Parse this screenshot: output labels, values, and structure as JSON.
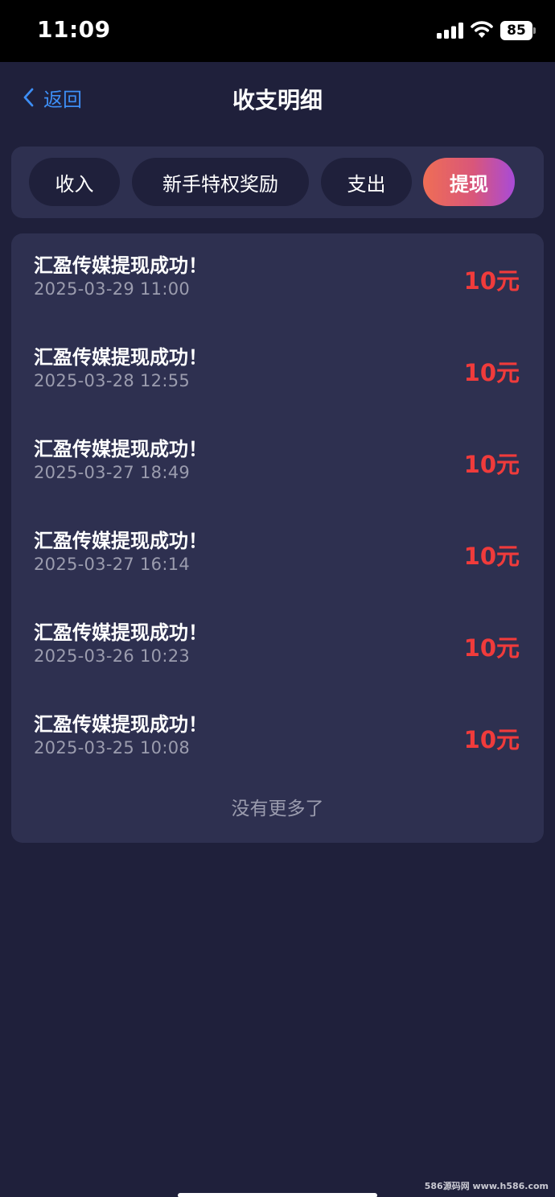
{
  "status_bar": {
    "time": "11:09",
    "battery": "85",
    "icons": [
      "signal-icon",
      "wifi-icon",
      "battery-icon"
    ]
  },
  "nav": {
    "back_label": "返回",
    "title": "收支明细"
  },
  "tabs": [
    {
      "label": "收入",
      "active": false
    },
    {
      "label": "新手特权奖励",
      "active": false
    },
    {
      "label": "支出",
      "active": false
    },
    {
      "label": "提现",
      "active": true
    }
  ],
  "records": [
    {
      "title": "汇盈传媒提现成功！",
      "time": "2025-03-29 11:00",
      "amount": "10元"
    },
    {
      "title": "汇盈传媒提现成功！",
      "time": "2025-03-28 12:55",
      "amount": "10元"
    },
    {
      "title": "汇盈传媒提现成功！",
      "time": "2025-03-27 18:49",
      "amount": "10元"
    },
    {
      "title": "汇盈传媒提现成功！",
      "time": "2025-03-27 16:14",
      "amount": "10元"
    },
    {
      "title": "汇盈传媒提现成功！",
      "time": "2025-03-26 10:23",
      "amount": "10元"
    },
    {
      "title": "汇盈传媒提现成功！",
      "time": "2025-03-25 10:08",
      "amount": "10元"
    }
  ],
  "footer": {
    "no_more": "没有更多了"
  },
  "watermark": "586源码网 www.h586.com",
  "colors": {
    "background": "#1f203b",
    "panel": "#2e3050",
    "accent_blue": "#3d8ef5",
    "amount_red": "#f03b3b",
    "active_tab_gradient": [
      "#ef6e55",
      "#a84bd8"
    ]
  }
}
